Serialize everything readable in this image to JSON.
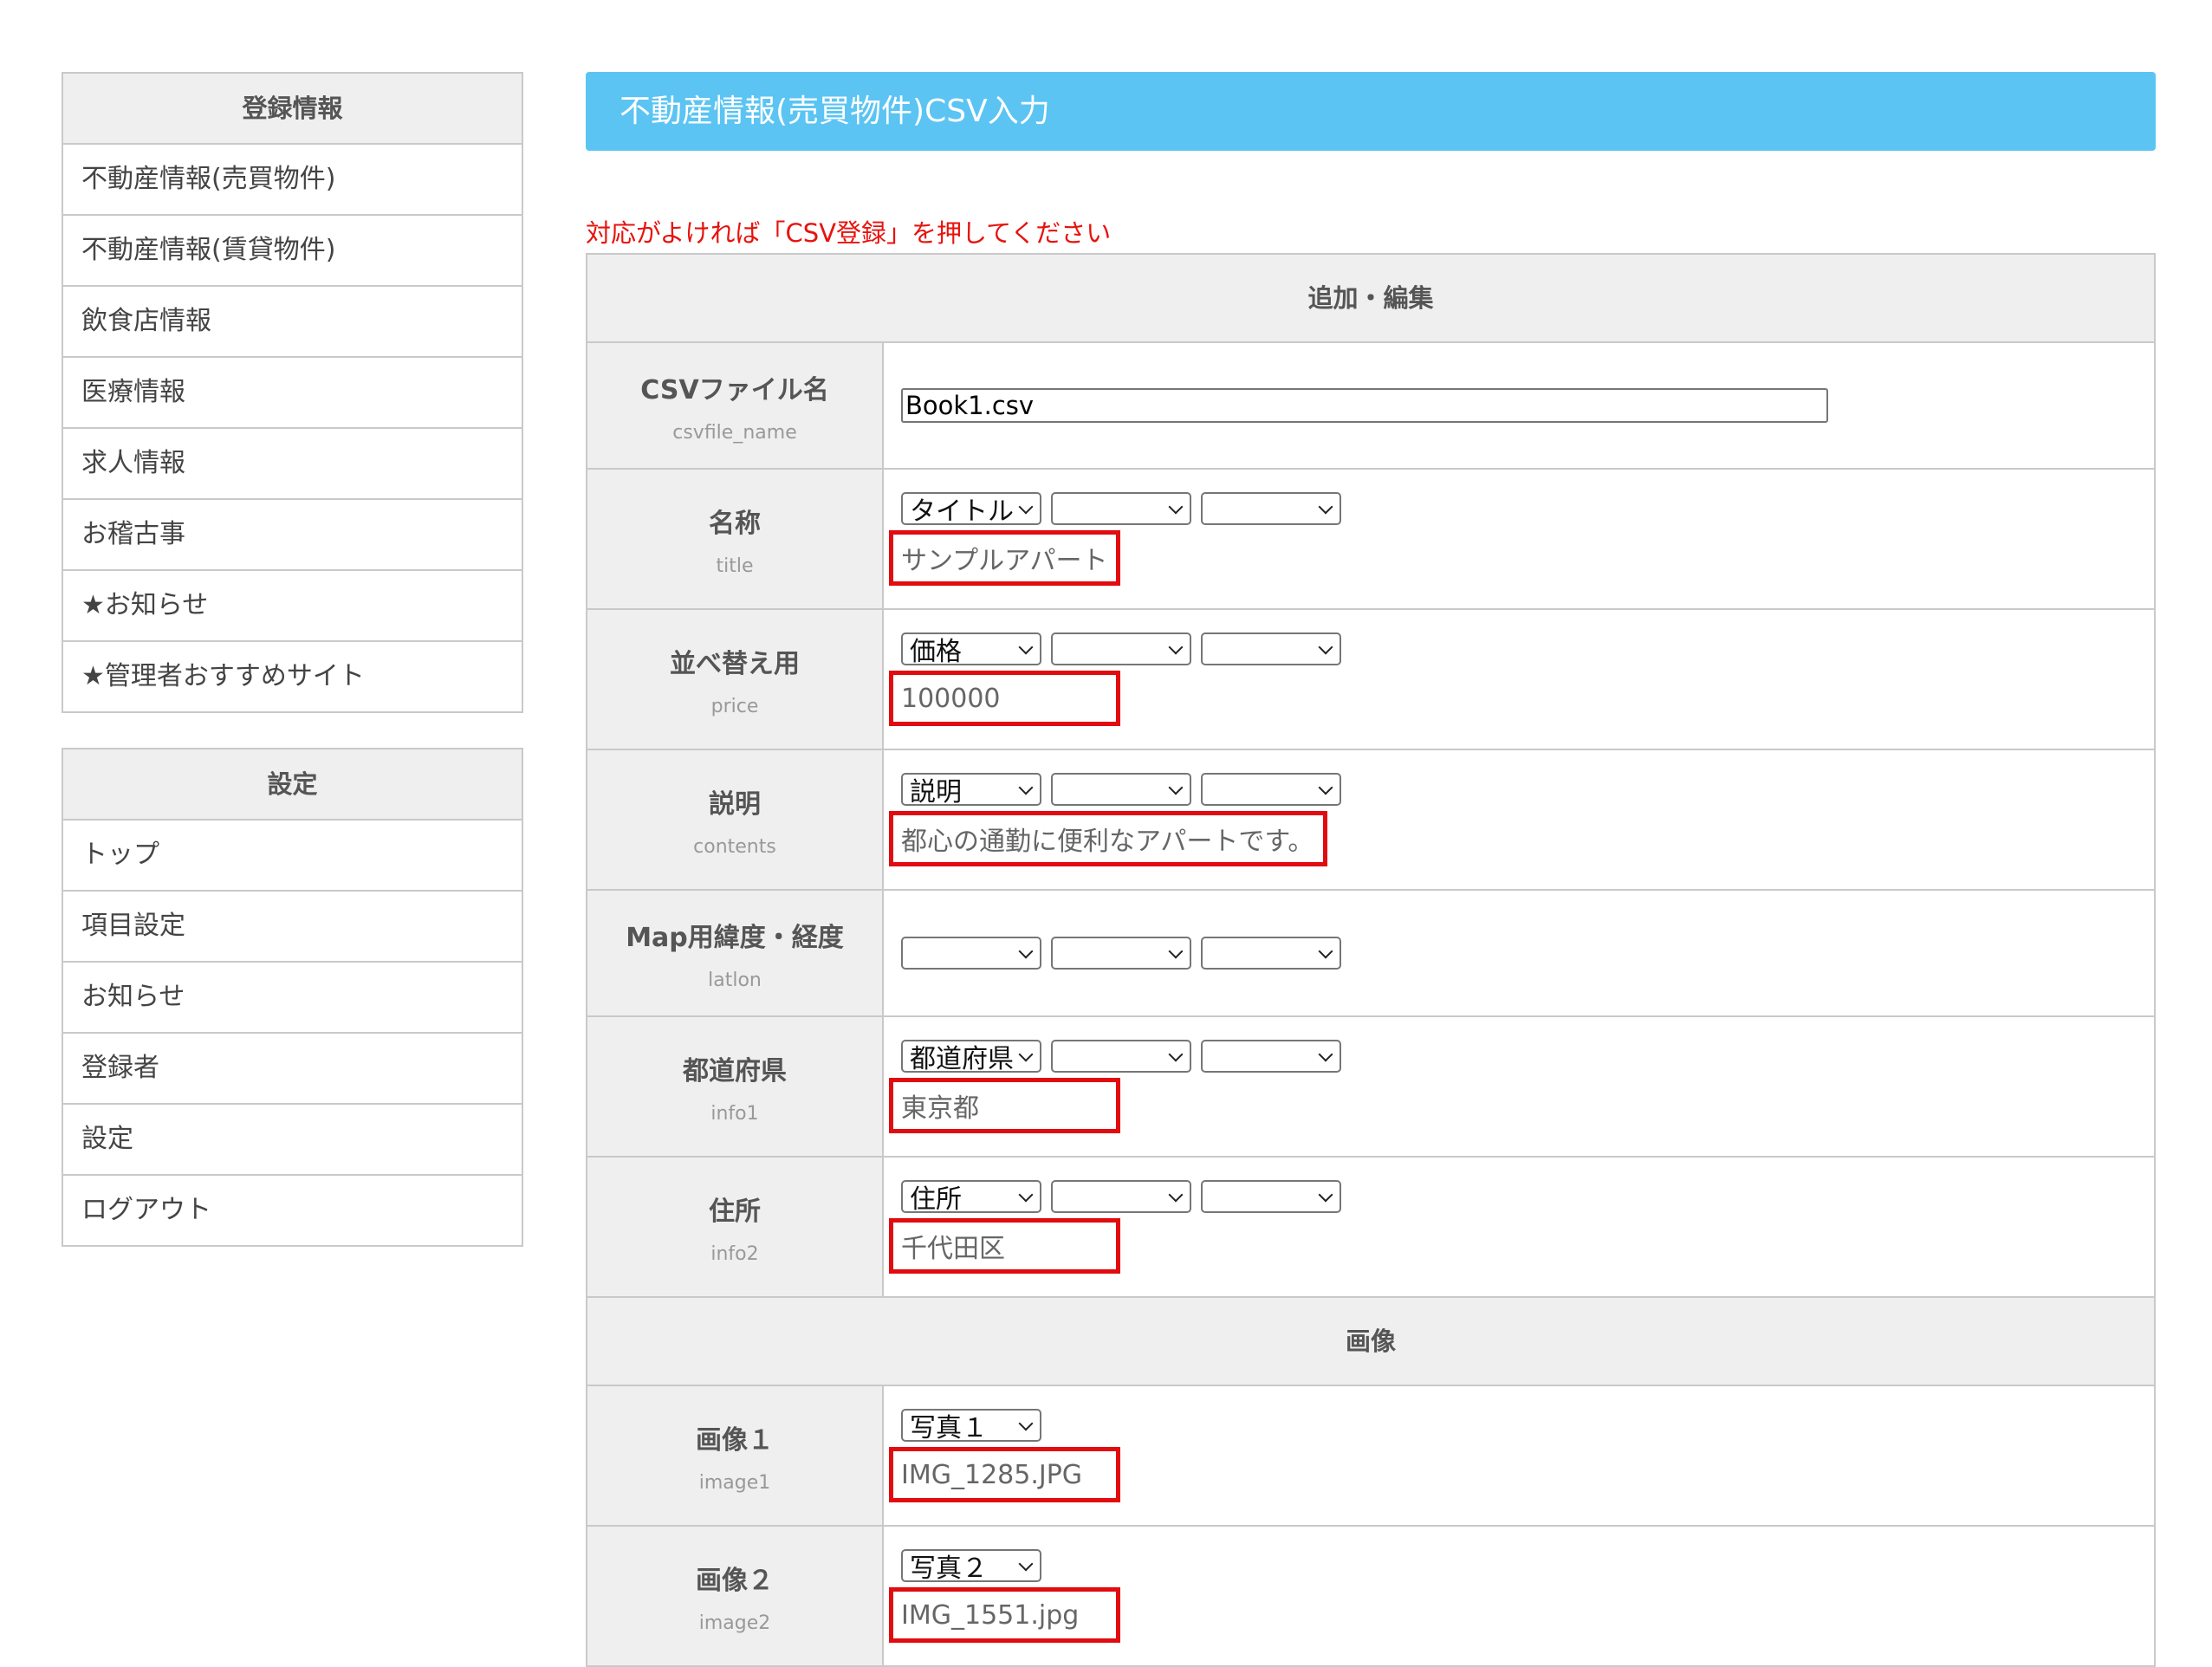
{
  "sidebar": {
    "registration": {
      "heading": "登録情報",
      "items": [
        {
          "label": "不動産情報(売買物件)"
        },
        {
          "label": "不動産情報(賃貸物件)"
        },
        {
          "label": "飲食店情報"
        },
        {
          "label": "医療情報"
        },
        {
          "label": "求人情報"
        },
        {
          "label": "お稽古事"
        },
        {
          "label": "★お知らせ"
        },
        {
          "label": "★管理者おすすめサイト"
        }
      ]
    },
    "settings": {
      "heading": "設定",
      "items": [
        {
          "label": "トップ"
        },
        {
          "label": "項目設定"
        },
        {
          "label": "お知らせ"
        },
        {
          "label": "登録者"
        },
        {
          "label": "設定"
        },
        {
          "label": "ログアウト"
        }
      ]
    }
  },
  "main": {
    "banner_title": "不動産情報(売買物件)CSV入力",
    "notice": "対応がよければ「CSV登録」を押してください",
    "section_edit": "追加・編集",
    "section_image": "画像",
    "csvfile": {
      "label": "CSVファイル名",
      "key": "csvfile_name",
      "value": "Book1.csv"
    },
    "fields": [
      {
        "label": "名称",
        "key": "title",
        "selects": [
          "タイトル",
          "",
          ""
        ],
        "sample": "サンプルアパート"
      },
      {
        "label": "並べ替え用",
        "key": "price",
        "selects": [
          "価格",
          "",
          ""
        ],
        "sample": "100000"
      },
      {
        "label": "説明",
        "key": "contents",
        "selects": [
          "説明",
          "",
          ""
        ],
        "sample": "都心の通勤に便利なアパートです。"
      },
      {
        "label": "Map用緯度・経度",
        "key": "latlon",
        "selects": [
          "",
          "",
          ""
        ],
        "sample": ""
      },
      {
        "label": "都道府県",
        "key": "info1",
        "selects": [
          "都道府県",
          "",
          ""
        ],
        "sample": "東京都"
      },
      {
        "label": "住所",
        "key": "info2",
        "selects": [
          "住所",
          "",
          ""
        ],
        "sample": "千代田区"
      }
    ],
    "images": [
      {
        "label": "画像１",
        "key": "image1",
        "select": "写真１",
        "sample": "IMG_1285.JPG"
      },
      {
        "label": "画像２",
        "key": "image2",
        "select": "写真２",
        "sample": "IMG_1551.jpg"
      }
    ]
  }
}
